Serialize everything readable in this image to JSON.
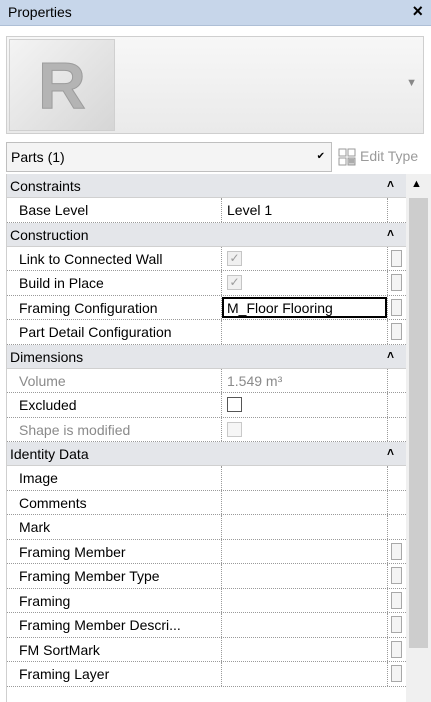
{
  "panel": {
    "title": "Properties",
    "close_glyph": "×",
    "logo_letter": "R"
  },
  "selector": {
    "value": "Parts (1)",
    "edit_type_label": "Edit Type"
  },
  "groups": [
    {
      "label": "Constraints",
      "rows": [
        {
          "name": "Base Level",
          "value": "Level 1",
          "type": "text",
          "assoc": false
        }
      ]
    },
    {
      "label": "Construction",
      "rows": [
        {
          "name": "Link to Connected Wall",
          "type": "checkbox",
          "checked": true,
          "state": "disabled",
          "assoc": true
        },
        {
          "name": "Build in Place",
          "type": "checkbox",
          "checked": true,
          "state": "disabled",
          "assoc": true
        },
        {
          "name": "Framing Configuration",
          "value": "M_Floor Flooring",
          "type": "edit",
          "assoc": true
        },
        {
          "name": "Part Detail Configuration",
          "value": "",
          "type": "text",
          "assoc": true
        }
      ]
    },
    {
      "label": "Dimensions",
      "rows": [
        {
          "name": "Volume",
          "value": "1.549 m³",
          "type": "text",
          "dim": true,
          "assoc": false
        },
        {
          "name": "Excluded",
          "type": "checkbox",
          "checked": false,
          "state": "enabled",
          "assoc": false
        },
        {
          "name": "Shape is modified",
          "type": "checkbox",
          "checked": false,
          "state": "readonly",
          "dim": true,
          "assoc": false
        }
      ]
    },
    {
      "label": "Identity Data",
      "rows": [
        {
          "name": "Image",
          "value": "",
          "type": "text",
          "assoc": false
        },
        {
          "name": "Comments",
          "value": "",
          "type": "text",
          "assoc": false
        },
        {
          "name": "Mark",
          "value": "",
          "type": "text",
          "assoc": false
        },
        {
          "name": "Framing Member",
          "value": "",
          "type": "text",
          "assoc": true
        },
        {
          "name": "Framing Member Type",
          "value": "",
          "type": "text",
          "assoc": true
        },
        {
          "name": "Framing",
          "value": "",
          "type": "text",
          "assoc": true
        },
        {
          "name": "Framing Member Descri...",
          "value": "",
          "type": "text",
          "assoc": true
        },
        {
          "name": "FM SortMark",
          "value": "",
          "type": "text",
          "assoc": true
        },
        {
          "name": "Framing Layer",
          "value": "",
          "type": "text",
          "assoc": true
        }
      ]
    }
  ]
}
